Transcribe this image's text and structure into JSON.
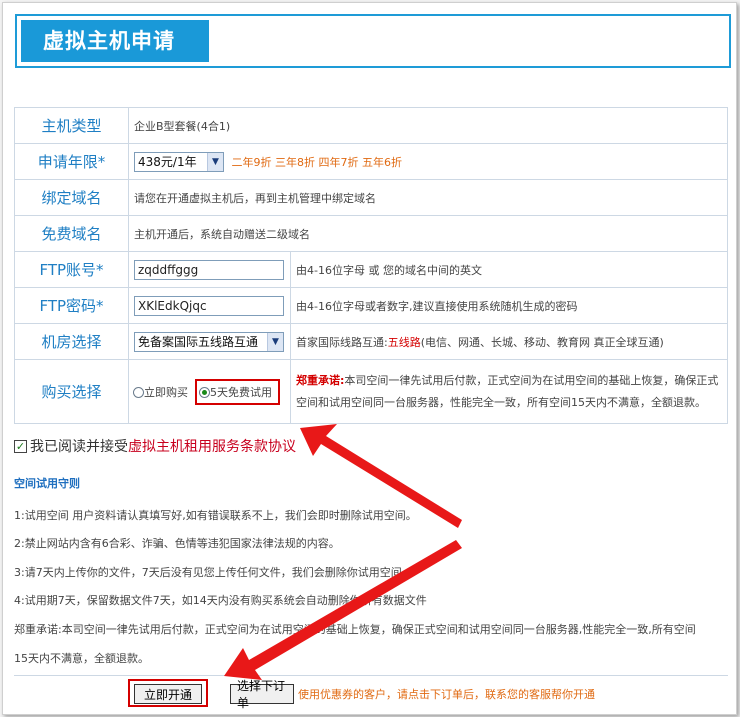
{
  "page_title": "虚拟主机申请",
  "form": {
    "rows": [
      {
        "label": "主机类型",
        "value": "企业B型套餐(4合1)"
      },
      {
        "label": "申请年限*",
        "select_value": "438元/1年",
        "discount": "二年9折 三年8折 四年7折 五年6折"
      },
      {
        "label": "绑定域名",
        "value": "请您在开通虚拟主机后，再到主机管理中绑定域名"
      },
      {
        "label": "免费域名",
        "value": "主机开通后，系统自动赠送二级域名"
      },
      {
        "label": "FTP账号*",
        "input_value": "zqddffggg",
        "hint": "由4-16位字母 或 您的域名中间的英文"
      },
      {
        "label": "FTP密码*",
        "input_value": "XKlEdkQjqc",
        "hint": "由4-16位字母或者数字,建议直接使用系统随机生成的密码"
      },
      {
        "label": "机房选择",
        "select_value": "免备案国际五线路互通",
        "hint_prefix": "首家国际线路互通:",
        "hint_highlight": "五线路",
        "hint_suffix": "(电信、网通、长城、移动、教育网 真正全球互通)"
      },
      {
        "label": "购买选择",
        "option_buy": "立即购买",
        "option_trial": "5天免费试用",
        "promise_label": "郑重承诺:",
        "promise_text": "本司空间一律先试用后付款，正式空间为在试用空间的基础上恢复，确保正式空间和试用空间同一台服务器，性能完全一致，所有空间15天内不满意，全额退款。"
      }
    ]
  },
  "agreement": {
    "prefix": "我已阅读并接受",
    "link": "虚拟主机租用服务条款协议"
  },
  "rules": {
    "title": "空间试用守则",
    "items": [
      "1:试用空间 用户资料请认真填写好,如有错误联系不上，我们会即时删除试用空间。",
      "2:禁止网站内含有6合彩、诈骗、色情等违犯国家法律法规的内容。",
      "3:请7天内上传你的文件，7天后没有见您上传任何文件，我们会删除你试用空间。",
      "4:试用期7天，保留数据文件7天，如14天内没有购买系统会自动删除你所有数据文件",
      "郑重承诺:本司空间一律先试用后付款，正式空间为在试用空间的基础上恢复，确保正式空间和试用空间同一台服务器,性能完全一致,所有空间",
      "15天内不满意，全额退款。"
    ]
  },
  "buttons": {
    "open_now": "立即开通",
    "choose_order": "选择下订单",
    "note": "使用优惠券的客户，请点击下订单后，联系您的客服帮你开通"
  },
  "colors": {
    "accent": "#1a99d8",
    "label": "#1f7fc4",
    "highlight_red": "#d40000",
    "discount_orange": "#e06a12"
  }
}
